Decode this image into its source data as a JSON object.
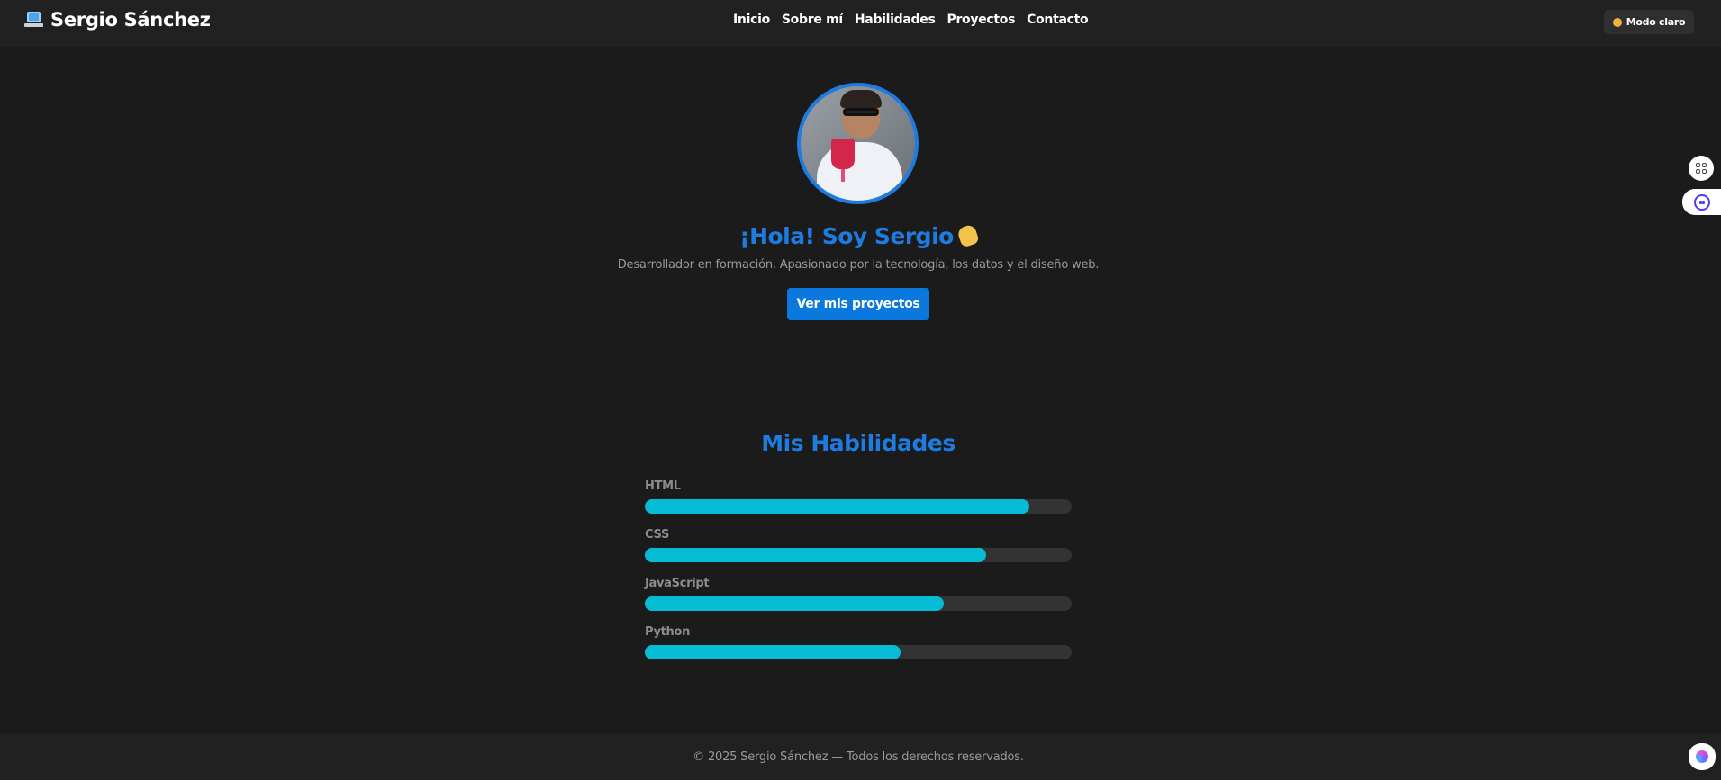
{
  "header": {
    "brand": "Sergio Sánchez",
    "brand_icon": "laptop-icon",
    "nav": [
      {
        "label": "Inicio"
      },
      {
        "label": "Sobre mí"
      },
      {
        "label": "Habilidades"
      },
      {
        "label": "Proyectos"
      },
      {
        "label": "Contacto"
      }
    ],
    "theme_toggle": {
      "label": "Modo claro",
      "icon": "sun-icon"
    }
  },
  "hero": {
    "title": "¡Hola! Soy Sergio",
    "title_icon": "waving-hand-icon",
    "subtitle": "Desarrollador en formación. Apasionado por la tecnología, los datos y el diseño web.",
    "cta_label": "Ver mis proyectos"
  },
  "skills": {
    "title": "Mis Habilidades",
    "items": [
      {
        "name": "HTML",
        "level": 0.9
      },
      {
        "name": "CSS",
        "level": 0.8
      },
      {
        "name": "JavaScript",
        "level": 0.7
      },
      {
        "name": "Python",
        "level": 0.6
      }
    ]
  },
  "footer": {
    "text": "© 2025 Sergio Sánchez — Todos los derechos reservados."
  },
  "colors": {
    "accent": "#1e7be0",
    "button": "#0a78dc",
    "skill_fill": "#06bcd4",
    "background": "#1b1b1b"
  }
}
